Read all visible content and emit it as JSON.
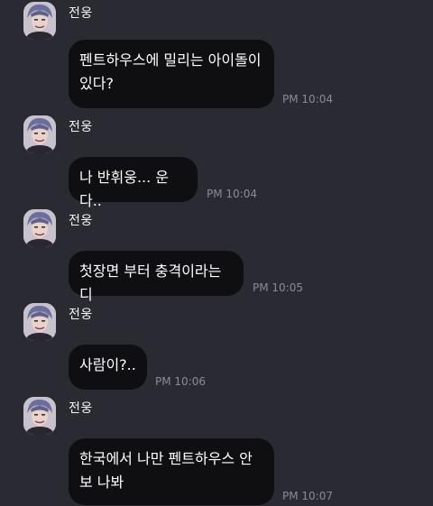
{
  "messages": [
    {
      "sender": "전웅",
      "text": "펜트하우스에 밀리는 아이돌이 있다?",
      "time": "PM 10:04"
    },
    {
      "sender": "전웅",
      "text": "나 반휘웅... 운다..",
      "time": "PM 10:04"
    },
    {
      "sender": "전웅",
      "text": "첫장면 부터 충격이라는디",
      "time": "PM 10:05"
    },
    {
      "sender": "전웅",
      "text": "사람이?..",
      "time": "PM 10:06"
    },
    {
      "sender": "전웅",
      "text": "한국에서 나만 펜트하우스 안보 나봐",
      "time": "PM 10:07"
    }
  ],
  "colors": {
    "background": "#2a2a32",
    "bubble": "#0f0f12",
    "time_text": "#8b8b93"
  },
  "icons": {
    "avatar": "user-avatar-photo"
  }
}
